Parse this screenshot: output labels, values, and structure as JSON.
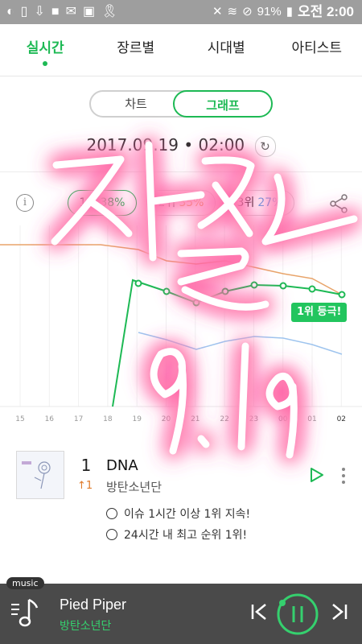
{
  "statusbar": {
    "battery": "91%",
    "time": "오전 2:00"
  },
  "tabs": [
    {
      "label": "실시간",
      "active": true
    },
    {
      "label": "장르별",
      "active": false
    },
    {
      "label": "시대별",
      "active": false
    },
    {
      "label": "아티스트",
      "active": false
    }
  ],
  "toggle": {
    "chart_label": "차트",
    "graph_label": "그래프",
    "selected": "그래프"
  },
  "datetime": "2017.09.19 • 02:00",
  "ranks": [
    {
      "label": "1위",
      "percent": "38%",
      "color": "#1db954"
    },
    {
      "label": "2위",
      "percent": "35%",
      "color": "#e8903b"
    },
    {
      "label": "3위",
      "percent": "27%",
      "color": "#5aa3e6"
    }
  ],
  "chart_data": {
    "type": "line",
    "x": [
      "15",
      "16",
      "17",
      "18",
      "19",
      "20",
      "21",
      "22",
      "23",
      "00",
      "01",
      "02"
    ],
    "series": [
      {
        "color": "#e8a46a",
        "values": [
          null,
          null,
          null,
          null,
          null,
          null,
          null,
          null,
          null,
          null,
          null,
          null
        ]
      },
      {
        "color": "#1db954",
        "values": [
          null,
          null,
          null,
          null,
          null,
          null,
          null,
          null,
          null,
          null,
          null,
          null
        ]
      },
      {
        "color": "#9ec4ee",
        "values": [
          null,
          null,
          null,
          null,
          null,
          null,
          null,
          null,
          null,
          null,
          null,
          null
        ]
      }
    ],
    "annotation": "1위 등극!",
    "grid": true
  },
  "song": {
    "rank": "1",
    "change": "↑1",
    "title": "DNA",
    "artist": "방탄소년단",
    "notes": [
      "이슈 1시간 이상 1위 지속!",
      "24시간 내 최고 순위 1위!"
    ]
  },
  "overlay": {
    "handwriting": "진 22스 9.19",
    "color": "#ff4fa0"
  },
  "player": {
    "tag": "music",
    "title": "Pied Piper",
    "artist": "방탄소년단"
  }
}
